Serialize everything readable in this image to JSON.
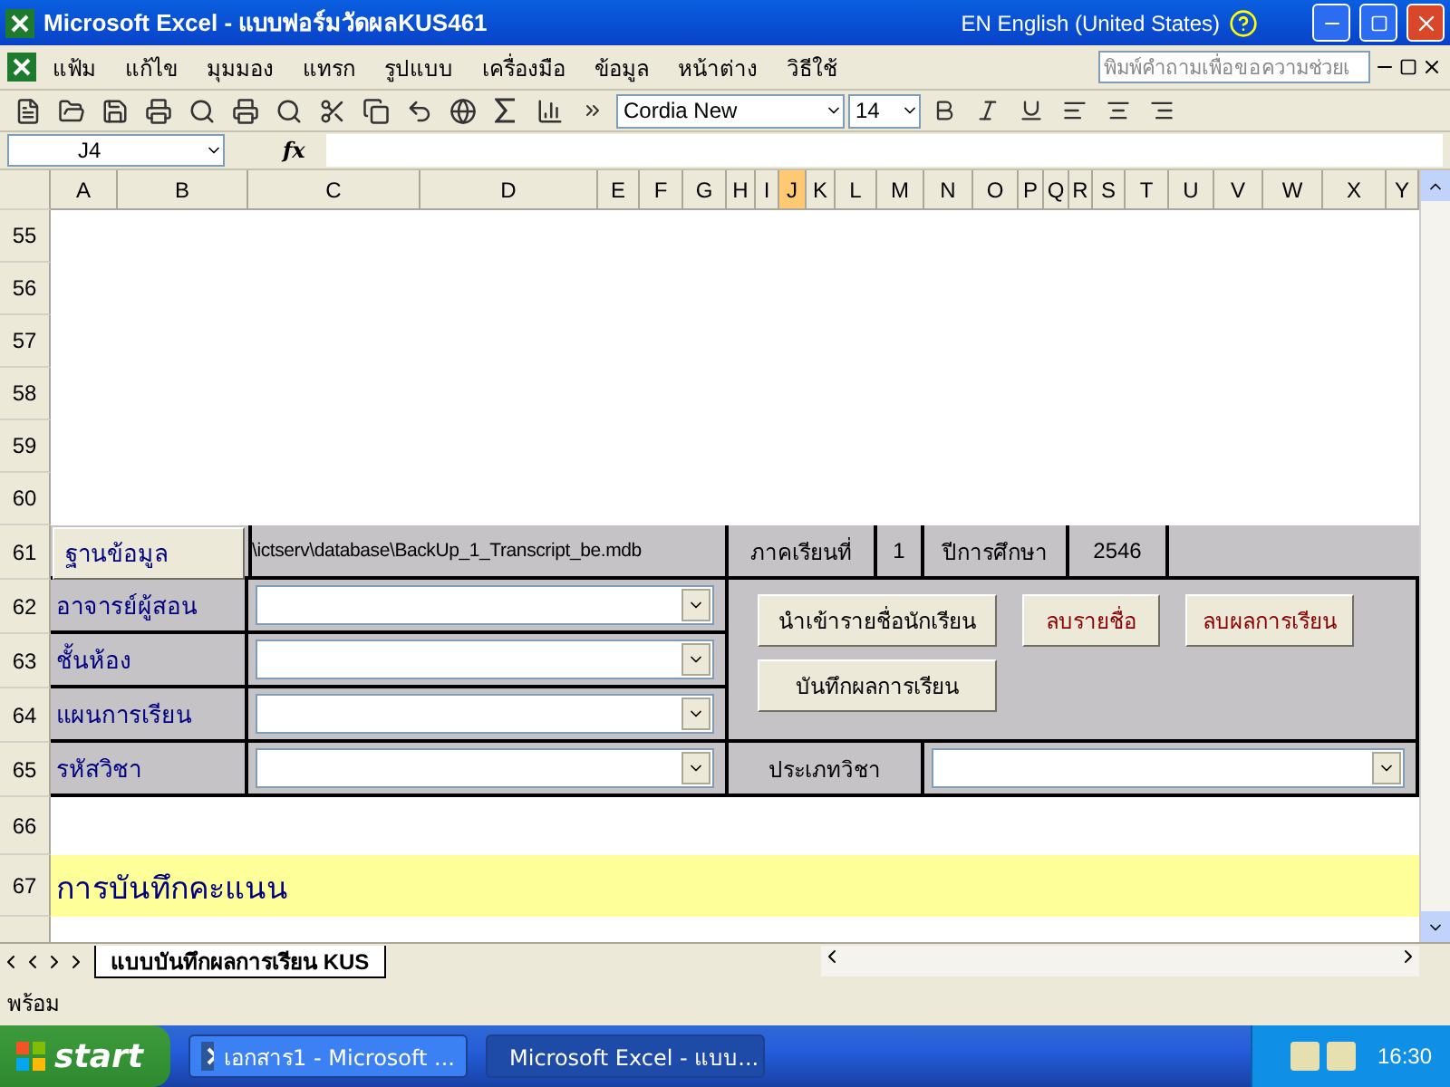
{
  "title_bar": {
    "title": "Microsoft Excel - แบบฟอร์มวัดผลKUS461",
    "language": "EN English (United States)"
  },
  "menu": {
    "items": [
      "แฟ้ม",
      "แก้ไข",
      "มุมมอง",
      "แทรก",
      "รูปแบบ",
      "เครื่องมือ",
      "ข้อมูล",
      "หน้าต่าง",
      "วิธีใช้"
    ],
    "help_placeholder": "พิมพ์คำถามเพื่อขอความช่วยเ"
  },
  "toolbar": {
    "font": "Cordia New",
    "size": "14"
  },
  "formula_bar": {
    "name_box": "J4",
    "fx": "fx"
  },
  "columns": [
    {
      "label": "A",
      "selected": false
    },
    {
      "label": "B",
      "selected": false
    },
    {
      "label": "C",
      "selected": false
    },
    {
      "label": "D",
      "selected": false
    },
    {
      "label": "E",
      "selected": false
    },
    {
      "label": "F",
      "selected": false
    },
    {
      "label": "G",
      "selected": false
    },
    {
      "label": "H",
      "selected": false
    },
    {
      "label": "I",
      "selected": false
    },
    {
      "label": "J",
      "selected": true
    },
    {
      "label": "K",
      "selected": false
    },
    {
      "label": "L",
      "selected": false
    },
    {
      "label": "M",
      "selected": false
    },
    {
      "label": "N",
      "selected": false
    },
    {
      "label": "O",
      "selected": false
    },
    {
      "label": "P",
      "selected": false
    },
    {
      "label": "Q",
      "selected": false
    },
    {
      "label": "R",
      "selected": false
    },
    {
      "label": "S",
      "selected": false
    },
    {
      "label": "T",
      "selected": false
    },
    {
      "label": "U",
      "selected": false
    },
    {
      "label": "V",
      "selected": false
    },
    {
      "label": "W",
      "selected": false
    },
    {
      "label": "X",
      "selected": false
    },
    {
      "label": "Y",
      "selected": false
    }
  ],
  "empty_rows": [
    "55",
    "56",
    "57",
    "58",
    "59",
    "60"
  ],
  "form": {
    "row_61": "61",
    "database_button": "ฐานข้อมูล",
    "database_path": "\\ictserv\\database\\BackUp_1_Transcript_be.mdb",
    "term_label": "ภาคเรียนที่",
    "term": "1",
    "year_label": "ปีการศึกษา",
    "year": "2546",
    "fields": [
      {
        "row": "62",
        "label": "อาจารย์ผู้สอน"
      },
      {
        "row": "63",
        "label": "ชั้นห้อง"
      },
      {
        "row": "64",
        "label": "แผนการเรียน"
      }
    ],
    "buttons": [
      {
        "label": "นำเข้ารายชื่อนักเรียน",
        "kind": "normal"
      },
      {
        "label": "ลบรายชื่อ",
        "kind": "danger"
      },
      {
        "label": "ลบผลการเรียน",
        "kind": "danger"
      },
      {
        "label": "บันทึกผลการเรียน",
        "kind": "normal"
      }
    ],
    "subject_row": "65",
    "subject_label": "รหัสวิชา",
    "subject_type_label": "ประเภทวิชา"
  },
  "row_66": "66",
  "section": {
    "row": "67",
    "title": "การบันทึกคะแนน"
  },
  "sheet_tabs": [
    {
      "label": "แบบบันทึกผลการเรียน KUS",
      "selected": true
    }
  ],
  "status": "พร้อม",
  "taskbar": {
    "start": "start",
    "tasks": [
      {
        "label": "เอกสาร1 - Microsoft ...",
        "selected": false,
        "kind": "word"
      },
      {
        "label": "Microsoft Excel - แบบ...",
        "selected": true,
        "kind": "excel"
      }
    ],
    "clock": "16:30"
  }
}
